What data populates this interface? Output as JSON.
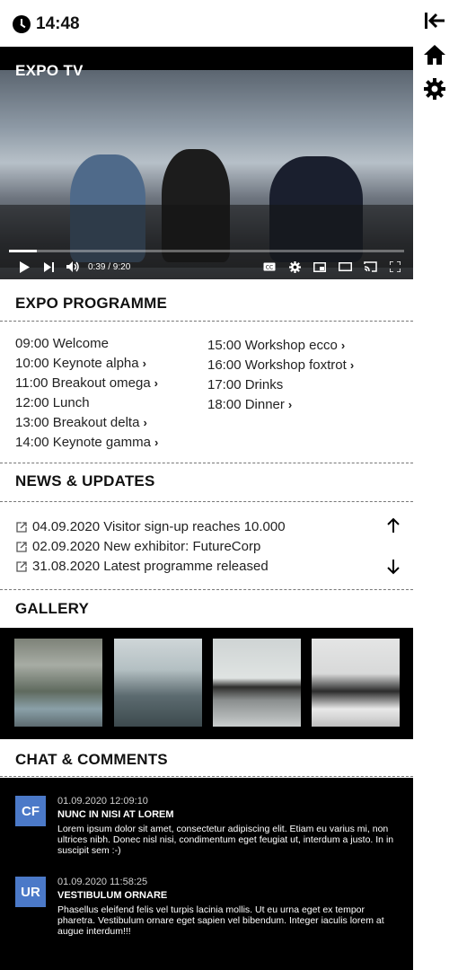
{
  "status": {
    "time": "14:48"
  },
  "rail": {
    "icons": [
      "collapse-left-icon",
      "home-icon",
      "gear-icon"
    ]
  },
  "video": {
    "title": "EXPO TV",
    "time_display": "0:39 / 9:20",
    "progress": 0.07
  },
  "programme": {
    "title": "EXPO PROGRAMME",
    "col1": [
      {
        "label": "09:00 Welcome",
        "has_link": false
      },
      {
        "label": "10:00 Keynote alpha",
        "has_link": true
      },
      {
        "label": "11:00 Breakout omega",
        "has_link": true
      },
      {
        "label": "12:00 Lunch",
        "has_link": false
      },
      {
        "label": "13:00 Breakout delta",
        "has_link": true
      },
      {
        "label": "14:00 Keynote gamma",
        "has_link": true
      }
    ],
    "col2": [
      {
        "label": "15:00 Workshop ecco",
        "has_link": true
      },
      {
        "label": "16:00 Workshop foxtrot",
        "has_link": true
      },
      {
        "label": "17:00 Drinks",
        "has_link": false
      },
      {
        "label": "18:00 Dinner",
        "has_link": true
      }
    ],
    "chevron": "›"
  },
  "news": {
    "title": "NEWS & UPDATES",
    "items": [
      "04.09.2020 Visitor sign-up reaches 10.000",
      "02.09.2020 New exhibitor: FutureCorp",
      "31.08.2020 Latest programme released"
    ]
  },
  "gallery": {
    "title": "GALLERY"
  },
  "chat": {
    "title": "CHAT & COMMENTS",
    "messages": [
      {
        "initials": "CF",
        "timestamp": "01.09.2020 12:09:10",
        "heading": "NUNC IN NISI AT LOREM",
        "text": "Lorem ipsum dolor sit amet, consectetur adipiscing elit. Etiam eu varius mi, non ultrices nibh. Donec nisl nisi, condimentum eget feugiat ut, interdum a justo. In in suscipit sem :-)"
      },
      {
        "initials": "UR",
        "timestamp": "01.09.2020 11:58:25",
        "heading": "VESTIBULUM ORNARE",
        "text": "Phasellus eleifend felis vel turpis lacinia mollis. Ut eu urna eget ex tempor pharetra. Vestibulum ornare eget sapien vel bibendum. Integer iaculis lorem at augue interdum!!!"
      }
    ]
  },
  "colors": {
    "avatar": "#4b79c8",
    "dark": "#000000"
  }
}
